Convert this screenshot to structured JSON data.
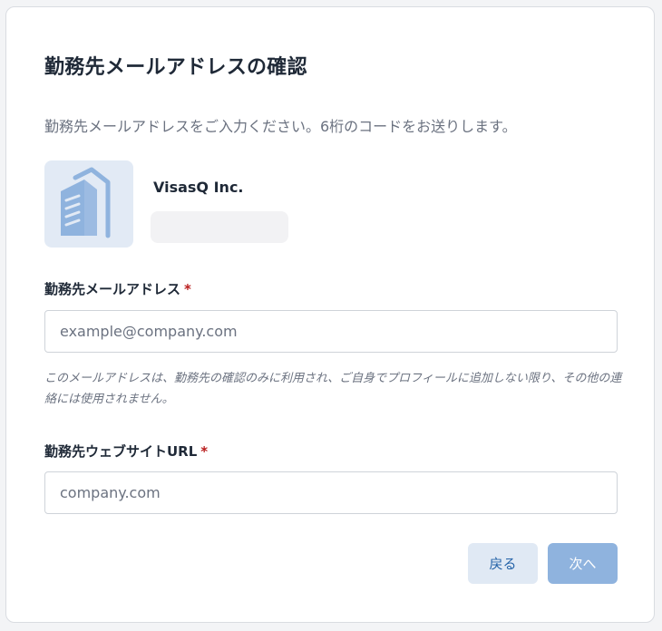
{
  "dialog": {
    "title": "勤務先メールアドレスの確認",
    "description": "勤務先メールアドレスをご入力ください。6桁のコードをお送りします。"
  },
  "company": {
    "name": "VisasQ Inc.",
    "logo_icon": "building-icon"
  },
  "email_field": {
    "label": "勤務先メールアドレス",
    "required_mark": "*",
    "value": "",
    "placeholder": "example@company.com",
    "hint": "このメールアドレスは、勤務先の確認のみに利用され、ご自身でプロフィールに追加しない限り、その他の連絡には使用されません。"
  },
  "website_field": {
    "label": "勤務先ウェブサイトURL",
    "required_mark": "*",
    "value": "",
    "placeholder": "company.com"
  },
  "actions": {
    "back_label": "戻る",
    "next_label": "次へ"
  },
  "colors": {
    "accent": "#2563a8",
    "next_button_disabled": "#8fb3de",
    "back_button_bg": "#e0e9f4",
    "logo_bg": "#e2eaf5",
    "logo_fg": "#8fb3de",
    "required": "#b91c1c"
  }
}
